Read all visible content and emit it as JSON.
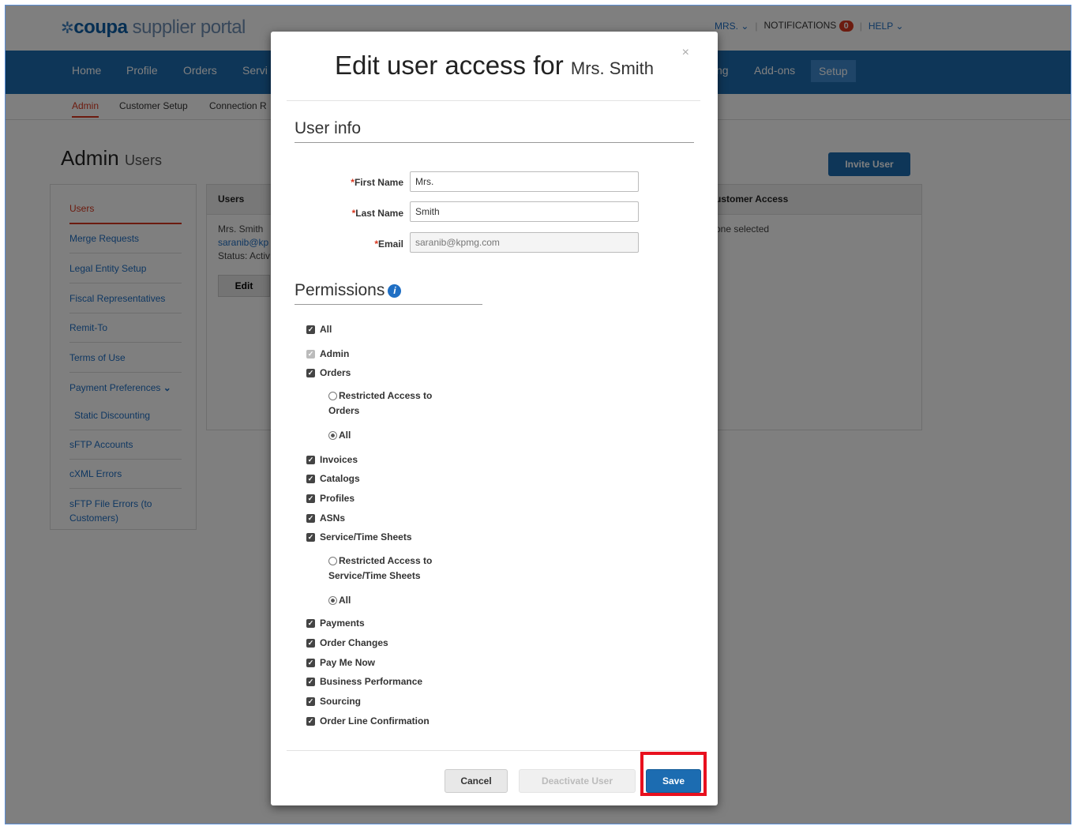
{
  "header": {
    "logo_brand": "coupa",
    "logo_suffix": "supplier portal",
    "user_menu": "MRS. ⌄",
    "notifications_label": "NOTIFICATIONS",
    "notifications_count": "0",
    "help_label": "HELP ⌄"
  },
  "nav": {
    "items": [
      "Home",
      "Profile",
      "Orders",
      "Servi",
      "ng",
      "Add-ons"
    ],
    "active": "Setup"
  },
  "subnav": {
    "items": [
      "Admin",
      "Customer Setup",
      "Connection R"
    ]
  },
  "page": {
    "title": "Admin",
    "subtitle": "Users",
    "invite_button": "Invite User"
  },
  "sidebar": {
    "items": [
      "Users",
      "Merge Requests",
      "Legal Entity Setup",
      "Fiscal Representatives",
      "Remit-To",
      "Terms of Use",
      "Payment Preferences",
      "Static Discounting",
      "sFTP Accounts",
      "cXML Errors",
      "sFTP File Errors (to Customers)"
    ]
  },
  "users_table": {
    "col_users": "Users",
    "col_customer_access": "ustomer Access",
    "user_name": "Mrs. Smith",
    "user_email": "saranib@kp",
    "user_status": "Status: Activ",
    "customer_access": "one selected",
    "edit_button": "Edit"
  },
  "modal": {
    "title": "Edit user access for",
    "title_name": "Mrs. Smith",
    "close": "×",
    "user_info_heading": "User info",
    "fields": {
      "first_name_label": "First Name",
      "first_name_value": "Mrs.",
      "last_name_label": "Last Name",
      "last_name_value": "Smith",
      "email_label": "Email",
      "email_value": "saranib@kpmg.com",
      "required_marker": "*"
    },
    "permissions_heading": "Permissions",
    "permissions": {
      "all": "All",
      "admin": "Admin",
      "orders": "Orders",
      "orders_restricted": "Restricted Access to Orders",
      "orders_all": "All",
      "invoices": "Invoices",
      "catalogs": "Catalogs",
      "profiles": "Profiles",
      "asns": "ASNs",
      "service_sheets": "Service/Time Sheets",
      "service_restricted": "Restricted Access to Service/Time Sheets",
      "service_all": "All",
      "payments": "Payments",
      "order_changes": "Order Changes",
      "pay_me_now": "Pay Me Now",
      "business_performance": "Business Performance",
      "sourcing": "Sourcing",
      "order_line_confirmation": "Order Line Confirmation"
    },
    "buttons": {
      "cancel": "Cancel",
      "deactivate": "Deactivate User",
      "save": "Save"
    }
  },
  "colors": {
    "brand_blue": "#1c6cb1",
    "alert_red": "#d9371f",
    "highlight_red": "#e8101e"
  }
}
